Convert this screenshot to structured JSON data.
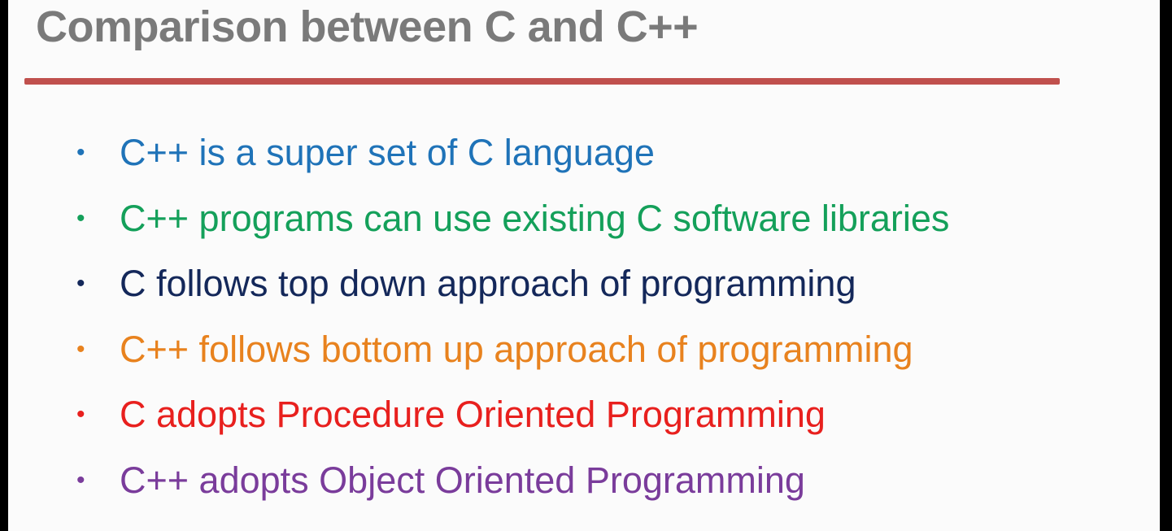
{
  "slide": {
    "title": "Comparison between C and C++",
    "colors": {
      "title": "#7a7a7a",
      "rule": "#c0504d",
      "background": "#fbfbfb"
    },
    "bullets": [
      {
        "text": "C++ is a super set of C language",
        "color": "#1f73b8",
        "marker": "•"
      },
      {
        "text": "C++ programs can use existing C software libraries",
        "color": "#14a05a",
        "marker": "•"
      },
      {
        "text": "C follows top down approach of programming",
        "color": "#14285a",
        "marker": "•"
      },
      {
        "text": "C++ follows bottom up approach of programming",
        "color": "#e8821e",
        "marker": "•"
      },
      {
        "text": "C adopts Procedure Oriented Programming",
        "color": "#e8201e",
        "marker": "•"
      },
      {
        "text": "C++ adopts Object Oriented Programming",
        "color": "#7a3c9b",
        "marker": "•"
      }
    ]
  }
}
